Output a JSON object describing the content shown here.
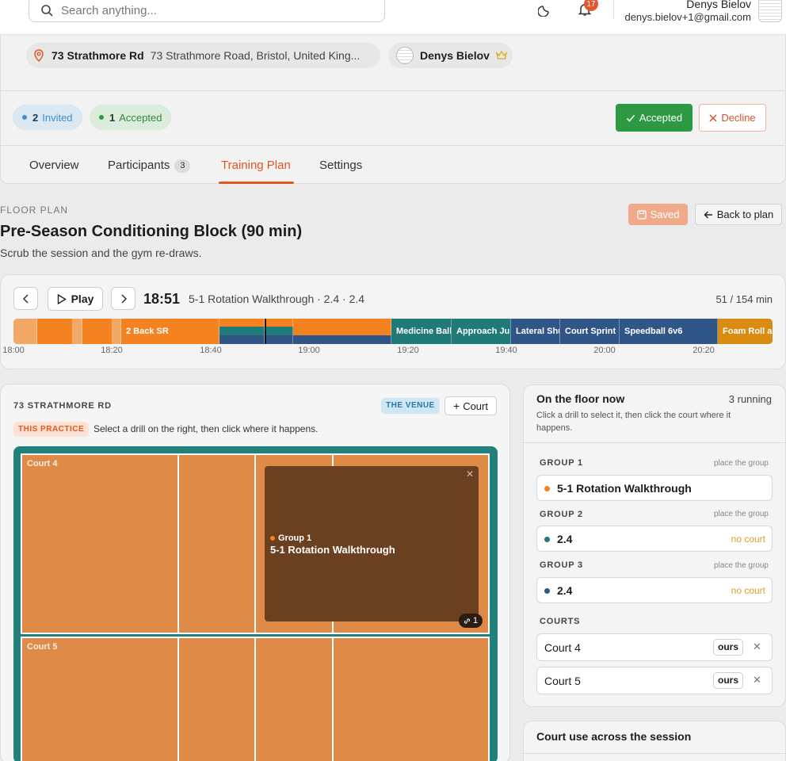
{
  "topbar": {
    "search_placeholder": "Search anything...",
    "notifications_count": "17",
    "user_name": "Denys Bielov",
    "user_email": "denys.bielov+1@gmail.com"
  },
  "header": {
    "location_name": "73 Strathmore Rd",
    "location_address": "73 Strathmore Road, Bristol, United King...",
    "owner_name": "Denys Bielov",
    "invited_count": "2",
    "invited_label": "Invited",
    "accepted_count": "1",
    "accepted_label": "Accepted",
    "accepted_button": "Accepted",
    "decline_button": "Decline",
    "tabs": [
      {
        "label": "Overview"
      },
      {
        "label": "Participants",
        "count": "3"
      },
      {
        "label": "Training Plan"
      },
      {
        "label": "Settings"
      }
    ]
  },
  "page": {
    "eyebrow": "FLOOR PLAN",
    "title": "Pre-Season Conditioning Block (90 min)",
    "subtitle": "Scrub the session and the gym re-draws.",
    "saved_button": "Saved",
    "back_button": "Back to plan"
  },
  "timeline": {
    "play_label": "Play",
    "current_time": "18:51",
    "current_label": "5-1 Rotation Walkthrough · 2.4 · 2.4",
    "progress_text": "51 / 154 min",
    "ticks": [
      "18:00",
      "18:20",
      "18:40",
      "19:00",
      "19:20",
      "19:40",
      "20:00",
      "20:20"
    ],
    "segments": [
      "2 Back SR",
      "Medicine Ball",
      "Approach Jum",
      "Lateral Shu",
      "Court Sprint I",
      "Speedball 6v6",
      "Foam Roll an"
    ],
    "colors": {
      "orange": "#f58220",
      "teal": "#1f7a78",
      "navy": "#2f5687",
      "gold": "#d98b12"
    }
  },
  "floor": {
    "title": "73 STRATHMORE RD",
    "venue_badge": "THE VENUE",
    "court_button": "Court",
    "practice_badge": "THIS PRACTICE",
    "practice_hint": "Select a drill on the right, then click where it happens.",
    "courts": [
      "Court 4",
      "Court 5"
    ],
    "drill": {
      "group": "Group 1",
      "name": "5-1 Rotation Walkthrough",
      "link_count": "1"
    }
  },
  "on_floor": {
    "title": "On the floor now",
    "running": "3 running",
    "help": "Click a drill to select it, then click the court where it happens.",
    "groups": [
      {
        "label": "GROUP 1",
        "hint": "place the group",
        "drill": "5-1 Rotation Walkthrough",
        "status": "",
        "color": "#f58220"
      },
      {
        "label": "GROUP 2",
        "hint": "place the group",
        "drill": "2.4",
        "status": "no court",
        "color": "#1f7a78"
      },
      {
        "label": "GROUP 3",
        "hint": "place the group",
        "drill": "2.4",
        "status": "no court",
        "color": "#2f5687"
      }
    ],
    "courts_label": "COURTS",
    "courts": [
      {
        "name": "Court 4",
        "tag": "ours"
      },
      {
        "name": "Court 5",
        "tag": "ours"
      }
    ]
  },
  "court_use": {
    "title": "Court use across the session"
  }
}
